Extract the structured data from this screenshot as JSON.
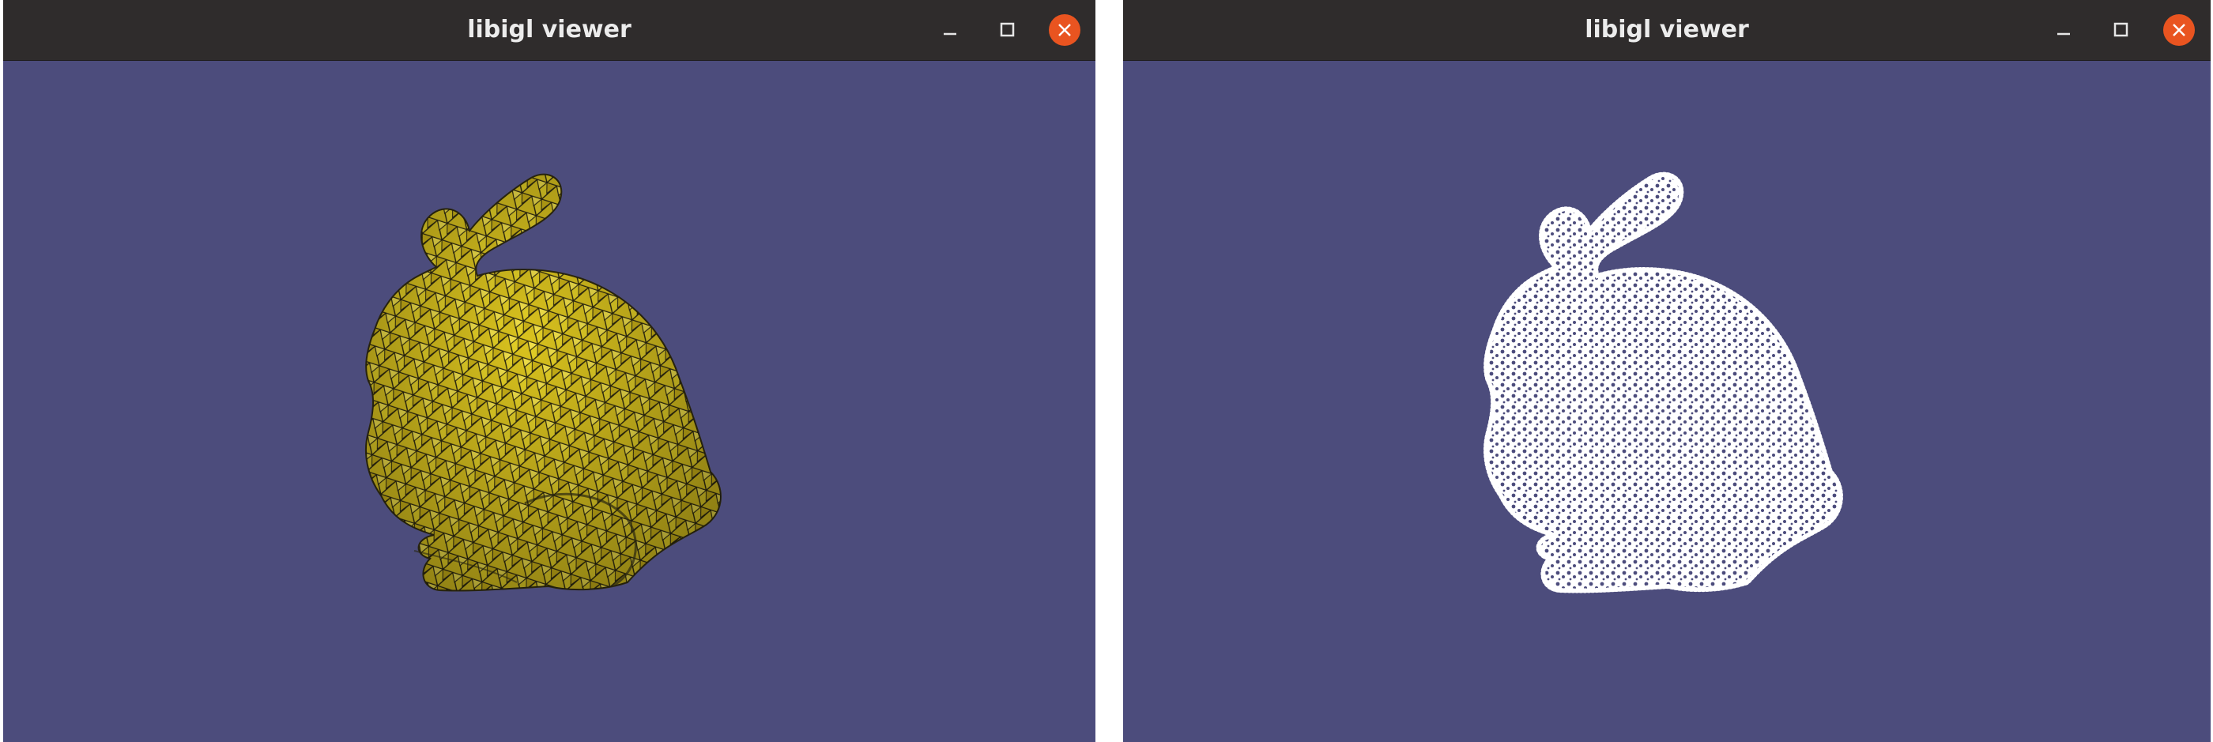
{
  "windows": [
    {
      "title": "libigl viewer",
      "render": "bunny-wireframe-yellow",
      "colors": {
        "background": "#4c4c7c",
        "mesh_fill": "#e8d52a",
        "mesh_edge": "#2a2610"
      }
    },
    {
      "title": "libigl viewer",
      "render": "bunny-point-cloud-white",
      "colors": {
        "background": "#4c4c7c",
        "points": "#ffffff"
      }
    }
  ],
  "titlebar": {
    "minimize_icon": "minimize-icon",
    "maximize_icon": "maximize-icon",
    "close_icon": "close-icon",
    "close_color": "#e95420"
  }
}
